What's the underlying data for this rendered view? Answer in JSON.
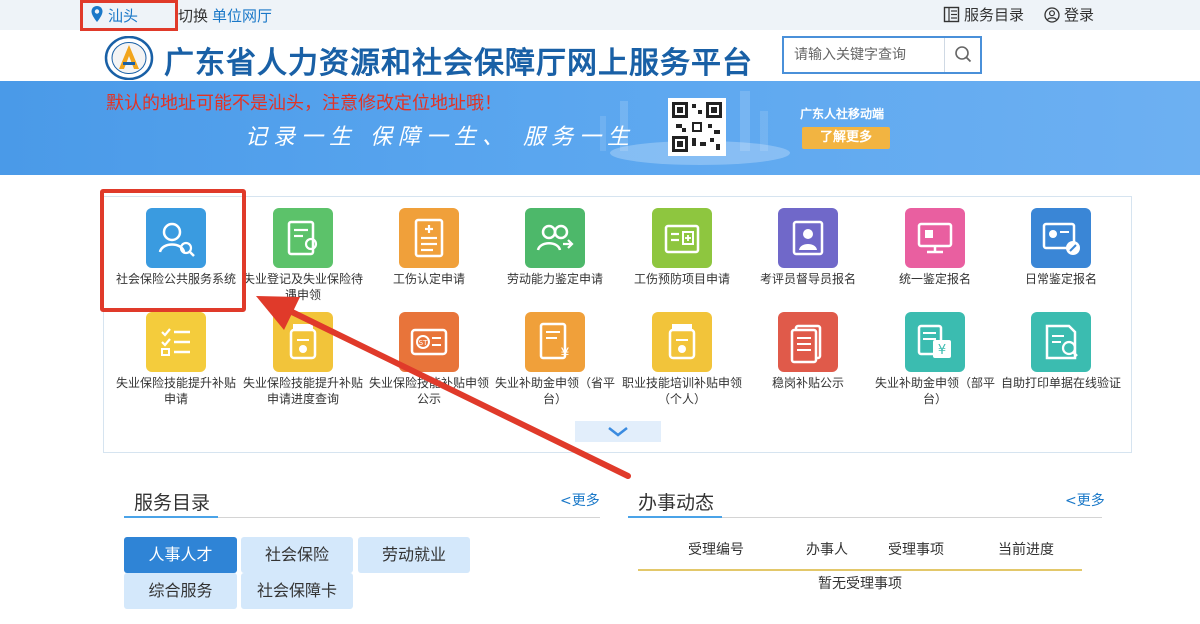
{
  "topbar": {
    "city": "汕头",
    "switch_label": "切换",
    "unit_hall": "单位网厅",
    "service_catalog": "服务目录",
    "login": "登录"
  },
  "header": {
    "title": "广东省人力资源和社会保障厅网上服务平台",
    "search_placeholder": "请输入关键字查询"
  },
  "banner": {
    "warning": "默认的地址可能不是汕头，注意修改定位地址哦！",
    "slogan": "记录一生  保障一生、 服务一生",
    "mobile_label": "广东人社移动端",
    "learn_more": "了解更多"
  },
  "services": [
    {
      "label": "社会保险公共服务系统",
      "icon": "user-search-icon",
      "color": "#3a9be0"
    },
    {
      "label": "失业登记及失业保险待遇申领",
      "icon": "form-user-icon",
      "color": "#5cc26a"
    },
    {
      "label": "工伤认定申请",
      "icon": "document-plus-icon",
      "color": "#f0a03a"
    },
    {
      "label": "劳动能力鉴定申请",
      "icon": "users-icon",
      "color": "#4db86a"
    },
    {
      "label": "工伤预防项目申请",
      "icon": "medical-card-icon",
      "color": "#8ec63f"
    },
    {
      "label": "考评员督导员报名",
      "icon": "id-badge-icon",
      "color": "#7068c9"
    },
    {
      "label": "统一鉴定报名",
      "icon": "monitor-icon",
      "color": "#e95fa0"
    },
    {
      "label": "日常鉴定报名",
      "icon": "id-card-edit-icon",
      "color": "#3a86d6"
    },
    {
      "label": "失业保险技能提升补贴申请",
      "icon": "checklist-icon",
      "color": "#f4cc3c"
    },
    {
      "label": "失业保险技能提升补贴申请进度查询",
      "icon": "pill-bottle-icon",
      "color": "#f2c43a"
    },
    {
      "label": "失业保险技能补贴申领公示",
      "icon": "st-card-icon",
      "color": "#e8743a"
    },
    {
      "label": "失业补助金申领（省平台）",
      "icon": "document-yen-icon",
      "color": "#f0a03a"
    },
    {
      "label": "职业技能培训补贴申领（个人）",
      "icon": "pill-bottle-icon",
      "color": "#f2c43a"
    },
    {
      "label": "稳岗补贴公示",
      "icon": "documents-icon",
      "color": "#e05a4a"
    },
    {
      "label": "失业补助金申领（部平台）",
      "icon": "yen-documents-icon",
      "color": "#3bbcb0"
    },
    {
      "label": "自助打印单据在线验证",
      "icon": "print-verify-icon",
      "color": "#3bbcb0"
    }
  ],
  "service_catalog_section": {
    "title": "服务目录",
    "more": "<更多",
    "categories": [
      {
        "label": "人事人才",
        "active": true
      },
      {
        "label": "社会保险",
        "active": false
      },
      {
        "label": "劳动就业",
        "active": false
      },
      {
        "label": "综合服务",
        "active": false
      },
      {
        "label": "社会保障卡",
        "active": false
      }
    ]
  },
  "news_section": {
    "title": "办事动态",
    "more": "<更多",
    "columns": [
      "受理编号",
      "办事人",
      "受理事项",
      "当前进度"
    ],
    "empty": "暂无受理事项"
  },
  "colors": {
    "brand_blue": "#1960a6",
    "link_blue": "#1a78c8",
    "warning_red": "#e23325",
    "highlight_red": "#e03a2a"
  }
}
